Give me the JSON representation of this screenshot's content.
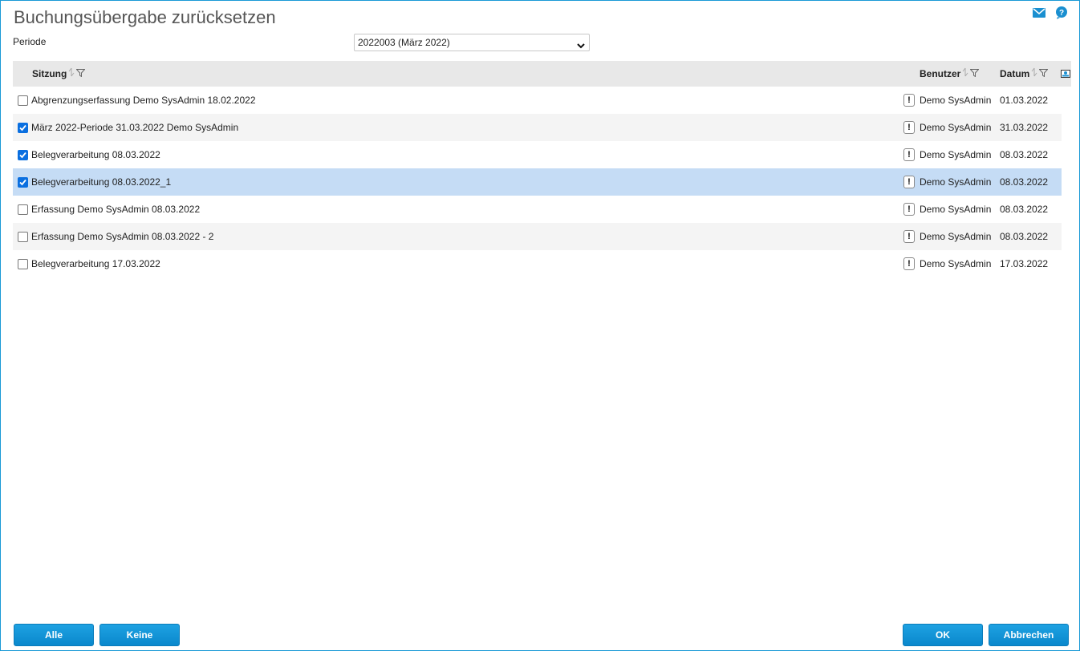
{
  "window": {
    "title": "Buchungsübergabe zurücksetzen",
    "icons": [
      "mail-icon",
      "help-icon"
    ],
    "border_color": "#1a9ad6"
  },
  "period": {
    "label": "Periode",
    "selected": "2022003 (März 2022)"
  },
  "table": {
    "columns": {
      "sitzung": "Sitzung",
      "benutzer": "Benutzer",
      "datum": "Datum"
    },
    "rows": [
      {
        "sitzung": "Abgrenzungserfassung Demo SysAdmin 18.02.2022",
        "warn": "!",
        "benutzer": "Demo SysAdmin",
        "datum": "01.03.2022",
        "checked": false
      },
      {
        "sitzung": "März 2022-Periode 31.03.2022 Demo SysAdmin",
        "warn": "!",
        "benutzer": "Demo SysAdmin",
        "datum": "31.03.2022",
        "checked": true
      },
      {
        "sitzung": "Belegverarbeitung 08.03.2022",
        "warn": "!",
        "benutzer": "Demo SysAdmin",
        "datum": "08.03.2022",
        "checked": true
      },
      {
        "sitzung": "Belegverarbeitung 08.03.2022_1",
        "warn": "!",
        "benutzer": "Demo SysAdmin",
        "datum": "08.03.2022",
        "checked": true
      },
      {
        "sitzung": "Erfassung Demo SysAdmin 08.03.2022",
        "warn": "!",
        "benutzer": "Demo SysAdmin",
        "datum": "08.03.2022",
        "checked": false
      },
      {
        "sitzung": "Erfassung Demo SysAdmin 08.03.2022 - 2",
        "warn": "!",
        "benutzer": "Demo SysAdmin",
        "datum": "08.03.2022",
        "checked": false
      },
      {
        "sitzung": "Belegverarbeitung 17.03.2022",
        "warn": "!",
        "benutzer": "Demo SysAdmin",
        "datum": "17.03.2022",
        "checked": false
      }
    ],
    "selected_row": 3
  },
  "buttons": {
    "alle": "Alle",
    "keine": "Keine",
    "ok": "OK",
    "abbrechen": "Abbrechen"
  },
  "colors": {
    "accent": "#0a88cc",
    "selected_row": "#c5dcf5",
    "header_bg": "#e8e8e8"
  }
}
